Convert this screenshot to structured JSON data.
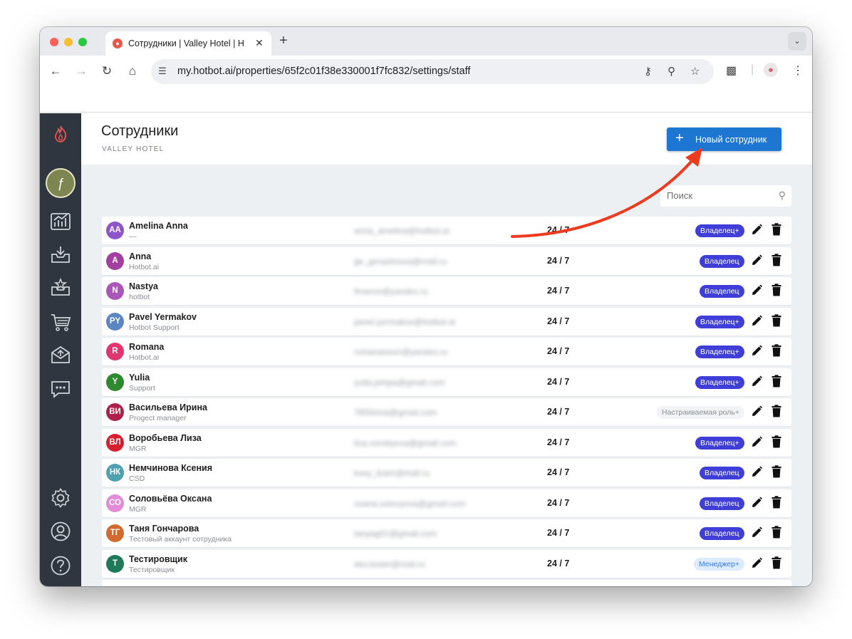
{
  "browser": {
    "tab_title": "Сотрудники | Valley Hotel | H",
    "url": "my.hotbot.ai/properties/65f2c01f38e330001f7fc832/settings/staff"
  },
  "page": {
    "title": "Сотрудники",
    "subtitle": "VALLEY HOTEL",
    "new_button": "Новый сотрудник",
    "search_placeholder": "Поиск"
  },
  "staff": [
    {
      "initials": "AA",
      "name": "Amelina Anna",
      "org": "—",
      "email": "anna_amelina@hotbot.ai",
      "schedule": "24 / 7",
      "role": "Владелец+",
      "role_kind": "owner",
      "color": "#8e54c9"
    },
    {
      "initials": "A",
      "name": "Anna",
      "org": "Hotbot.ai",
      "email": "ge_gerasimova@mail.ru",
      "schedule": "24 / 7",
      "role": "Владелец",
      "role_kind": "owner",
      "color": "#a33f9f"
    },
    {
      "initials": "N",
      "name": "Nastya",
      "org": "hotbot",
      "email": "finance@yandex.ru",
      "schedule": "24 / 7",
      "role": "Владелец",
      "role_kind": "owner",
      "color": "#a957b8"
    },
    {
      "initials": "PY",
      "name": "Pavel Yermakov",
      "org": "Hotbot Support",
      "email": "pavel.yermakov@hotbot.ai",
      "schedule": "24 / 7",
      "role": "Владелец+",
      "role_kind": "owner",
      "color": "#5b86c2"
    },
    {
      "initials": "R",
      "name": "Romana",
      "org": "Hotbot.ai",
      "email": "romanasoun@yandex.ru",
      "schedule": "24 / 7",
      "role": "Владелец+",
      "role_kind": "owner",
      "color": "#e0356e"
    },
    {
      "initials": "Y",
      "name": "Yulia",
      "org": "Support",
      "email": "yulia.pimpa@gmail.com",
      "schedule": "24 / 7",
      "role": "Владелец+",
      "role_kind": "owner",
      "color": "#2f8a2f"
    },
    {
      "initials": "ВИ",
      "name": "Васильева Ирина",
      "org": "Progect manager",
      "email": "7855irina@gmail.com",
      "schedule": "24 / 7",
      "role": "Настраиваемая роль+",
      "role_kind": "custom",
      "color": "#b01e4a"
    },
    {
      "initials": "ВЛ",
      "name": "Воробьева Лиза",
      "org": "MGR",
      "email": "liza.vorobyeva@gmail.com",
      "schedule": "24 / 7",
      "role": "Владелец+",
      "role_kind": "owner",
      "color": "#d81f2f"
    },
    {
      "initials": "НК",
      "name": "Немчинова Ксения",
      "org": "CSD",
      "email": "ksey_team@mail.ru",
      "schedule": "24 / 7",
      "role": "Владелец",
      "role_kind": "owner",
      "color": "#4fa0b0"
    },
    {
      "initials": "СО",
      "name": "Соловьёва Оксана",
      "org": "MGR",
      "email": "oxana.solovyova@gmail.com",
      "schedule": "24 / 7",
      "role": "Владелец",
      "role_kind": "owner",
      "color": "#e28bd6"
    },
    {
      "initials": "ТГ",
      "name": "Таня Гончарова",
      "org": "Тестовый аккаунт сотрудника",
      "email": "tanyag01@gmail.com",
      "schedule": "24 / 7",
      "role": "Владелец",
      "role_kind": "owner",
      "color": "#d26a2f"
    },
    {
      "initials": "Т",
      "name": "Тестировщик",
      "org": "Тестировщик",
      "email": "dev.tester@mail.ru",
      "schedule": "24 / 7",
      "role": "Менеджер+",
      "role_kind": "manager",
      "color": "#1f7a5a"
    }
  ],
  "icons": {
    "sidebar": [
      "flame-logo-icon",
      "avatar",
      "analytics-icon",
      "inbox-icon",
      "reviews-icon",
      "cart-icon",
      "mail-icon",
      "chat-icon",
      "settings-icon",
      "profile-icon",
      "help-icon"
    ]
  },
  "colors": {
    "accent": "#1e76d3",
    "owner_badge": "#3f3ed9",
    "annotation_arrow": "#ee3a1e",
    "sidebar_bg": "#2f3640"
  }
}
